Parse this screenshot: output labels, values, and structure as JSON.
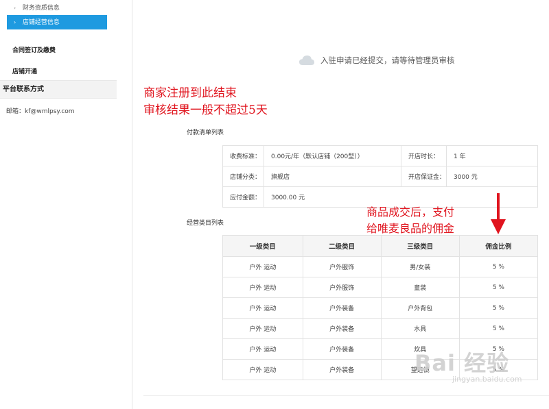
{
  "sidebar": {
    "sub_items": [
      {
        "label": "财务资质信息",
        "active": false
      },
      {
        "label": "店铺经营信息",
        "active": true
      }
    ],
    "nav_items": [
      "合同签订及缴费",
      "店铺开通"
    ],
    "contact_title": "平台联系方式",
    "email": "邮箱：kf@wmlpsy.com"
  },
  "main": {
    "notice": "入驻申请已经提交，请等待管理员审核",
    "red_note_1": "商家注册到此结束",
    "red_note_2": "审核结果一般不超过5天",
    "red_right_1": "商品成交后，支付",
    "red_right_2": "给唯麦良品的佣金",
    "payment": {
      "title": "付款清单列表",
      "rows": [
        [
          "收费标准：",
          "0.00元/年（默认店铺（200型））",
          "开店时长：",
          "1 年"
        ],
        [
          "店铺分类：",
          "旗舰店",
          "开店保证金：",
          "3000 元"
        ],
        [
          "应付金额：",
          "3000.00 元"
        ]
      ]
    },
    "categories": {
      "title": "经营类目列表",
      "headers": [
        "一级类目",
        "二级类目",
        "三级类目",
        "佣金比例"
      ],
      "rows": [
        [
          "户外 运动",
          "户外服饰",
          "男/女装",
          "5 %"
        ],
        [
          "户外 运动",
          "户外服饰",
          "童装",
          "5 %"
        ],
        [
          "户外 运动",
          "户外装备",
          "户外背包",
          "5 %"
        ],
        [
          "户外 运动",
          "户外装备",
          "水具",
          "5 %"
        ],
        [
          "户外 运动",
          "户外装备",
          "炊具",
          "5 %"
        ],
        [
          "户外 运动",
          "户外装备",
          "望远镜",
          "5 %"
        ]
      ]
    }
  },
  "watermark": {
    "big": "Bai 经验",
    "small": "jingyan.baidu.com"
  }
}
